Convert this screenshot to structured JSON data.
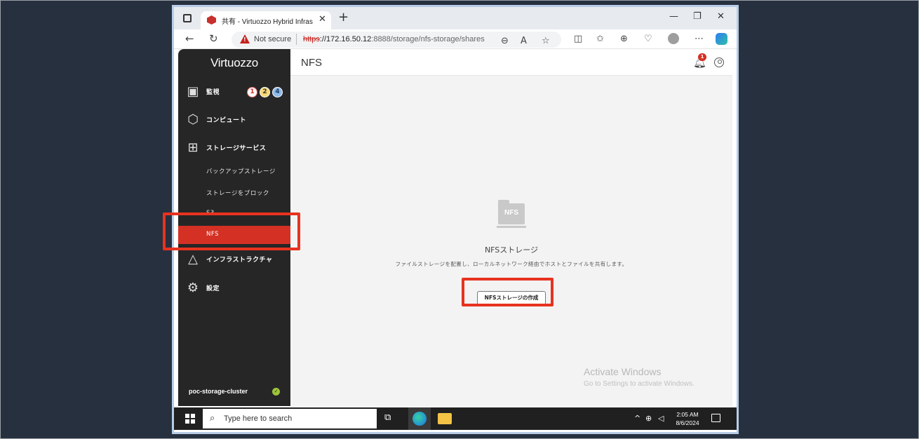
{
  "browser": {
    "tab_title": "共有 - Virtuozzo Hybrid Infrastru",
    "security_label": "Not secure",
    "url_scheme": "https",
    "url_host": "://172.16.50.12",
    "url_path": ":8888/storage/nfs-storage/shares"
  },
  "app": {
    "logo": "Virtuozzo",
    "page_title": "NFS",
    "notification_count": "1"
  },
  "sidebar": {
    "monitor_label": "監視",
    "monitor_badges": [
      "1",
      "2",
      "4"
    ],
    "compute_label": "コンピュート",
    "storage_label": "ストレージサービス",
    "sub_items": [
      "バックアップストレージ",
      "ストレージをブロック",
      "S3",
      "NFS"
    ],
    "infra_label": "インフラストラクチャ",
    "settings_label": "設定",
    "cluster_name": "poc-storage-cluster"
  },
  "empty_state": {
    "graphic_label": "NFS",
    "title": "NFSストレージ",
    "description": "ファイルストレージを配置し、ローカルネットワーク経由でホストとファイルを共有します。",
    "button_label": "NFSストレージの作成"
  },
  "watermark": {
    "title": "Activate Windows",
    "subtitle": "Go to Settings to activate Windows."
  },
  "taskbar": {
    "search_placeholder": "Type here to search",
    "time": "2:05 AM",
    "date": "8/6/2024"
  },
  "colors": {
    "sidebar_bg": "#262626",
    "active_item": "#d43024",
    "highlight": "#e8321f"
  }
}
